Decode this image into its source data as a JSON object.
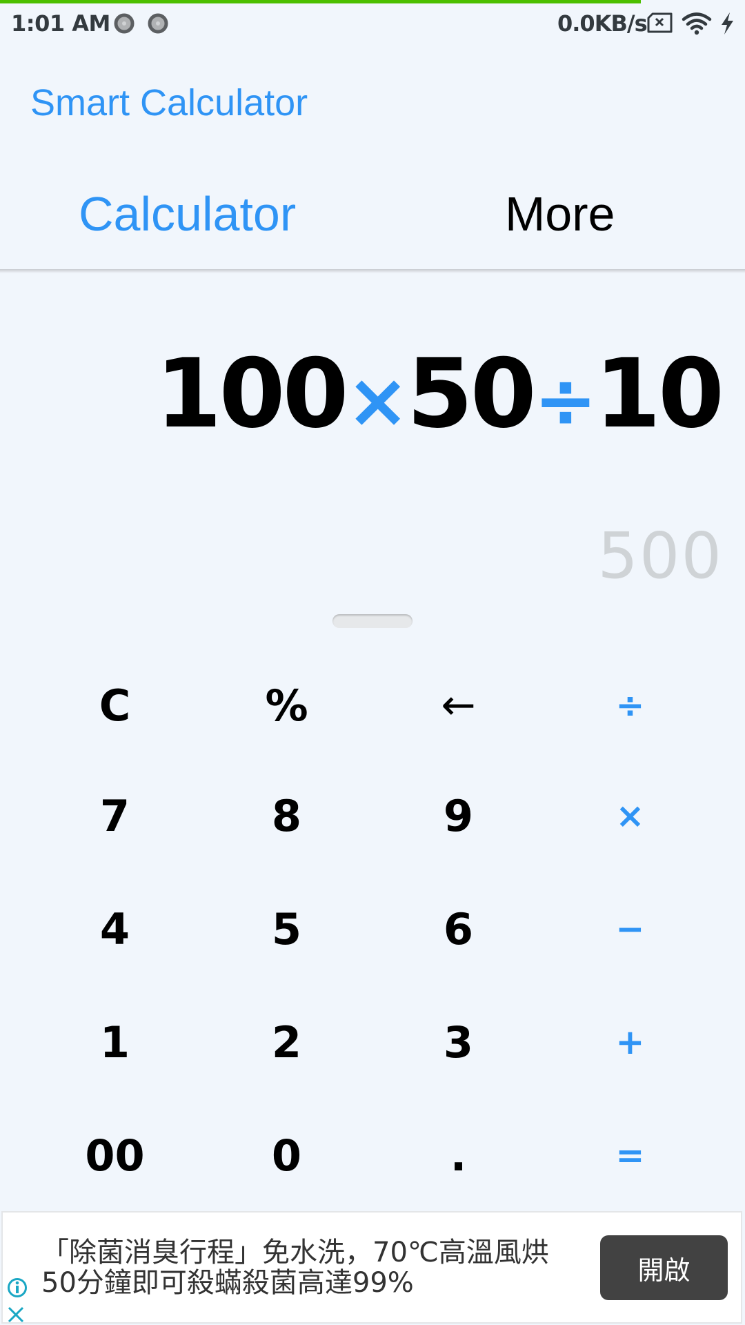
{
  "status_bar": {
    "time": "1:01 AM",
    "network_speed": "0.0KB/s",
    "icons": [
      "notification-dot-icon",
      "notification-dot-icon",
      "sim-missing-icon",
      "wifi-icon",
      "charging-icon"
    ]
  },
  "page_load_progress": 0.86,
  "app": {
    "title": "Smart Calculator"
  },
  "tabs": [
    {
      "label": "Calculator",
      "active": true
    },
    {
      "label": "More",
      "active": false
    }
  ],
  "display": {
    "expression": [
      {
        "type": "num",
        "text": "100"
      },
      {
        "type": "op",
        "text": "×"
      },
      {
        "type": "num",
        "text": "50"
      },
      {
        "type": "op",
        "text": "÷"
      },
      {
        "type": "num",
        "text": "10"
      }
    ],
    "result": "500"
  },
  "keypad": {
    "rows": [
      [
        {
          "label": "C",
          "kind": "func"
        },
        {
          "label": "%",
          "kind": "func"
        },
        {
          "label": "←",
          "kind": "back"
        },
        {
          "label": "÷",
          "kind": "op"
        }
      ],
      [
        {
          "label": "7",
          "kind": "num"
        },
        {
          "label": "8",
          "kind": "num"
        },
        {
          "label": "9",
          "kind": "num"
        },
        {
          "label": "×",
          "kind": "op"
        }
      ],
      [
        {
          "label": "4",
          "kind": "num"
        },
        {
          "label": "5",
          "kind": "num"
        },
        {
          "label": "6",
          "kind": "num"
        },
        {
          "label": "−",
          "kind": "op"
        }
      ],
      [
        {
          "label": "1",
          "kind": "num"
        },
        {
          "label": "2",
          "kind": "num"
        },
        {
          "label": "3",
          "kind": "num"
        },
        {
          "label": "+",
          "kind": "op"
        }
      ],
      [
        {
          "label": "00",
          "kind": "num"
        },
        {
          "label": "0",
          "kind": "num"
        },
        {
          "label": ".",
          "kind": "num"
        },
        {
          "label": "=",
          "kind": "op"
        }
      ]
    ]
  },
  "ad": {
    "line1": "「除菌消臭行程」免水洗，70℃高溫風烘",
    "line2": "50分鐘即可殺蟎殺菌高達99%",
    "button_label": "開啟"
  },
  "colors": {
    "accent": "#2f94f5",
    "background": "#f1f6fc",
    "progress": "#4cbf00",
    "result_text": "#cfd3d6",
    "ad_button": "#424242"
  }
}
